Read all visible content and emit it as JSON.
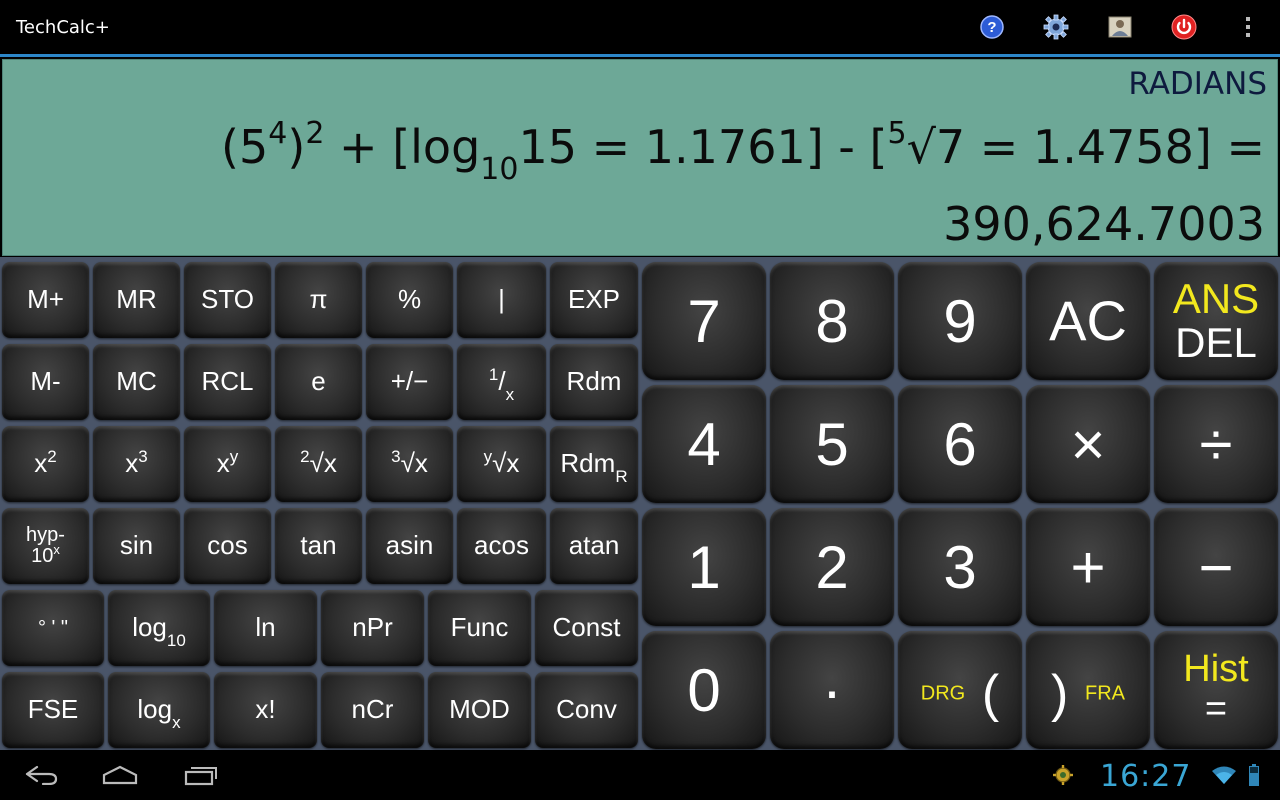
{
  "app": {
    "title": "TechCalc+"
  },
  "actionbar": {
    "icons": [
      "help-icon",
      "settings-icon",
      "contact-icon",
      "power-icon",
      "overflow-menu-icon"
    ]
  },
  "display": {
    "mode": "RADIANS",
    "expr": {
      "p1": "(5",
      "s1": "4",
      "p2": ")",
      "s2": "2",
      "p3": " + [log",
      "sub1": "10",
      "p4": "15 = 1.1761] - [",
      "s3": "5",
      "p5": "√7 = 1.4758] ="
    },
    "result": "390,624.7003"
  },
  "sci_keys": {
    "m_plus": "M+",
    "mr": "MR",
    "sto": "STO",
    "pi": "π",
    "percent": "%",
    "bar": "|",
    "exp": "EXP",
    "m_minus": "M-",
    "mc": "MC",
    "rcl": "RCL",
    "e": "e",
    "plus_minus": "+/−",
    "recip_num": "1",
    "recip_den": "x",
    "rdm": "Rdm",
    "sq_base": "x",
    "sq_exp": "2",
    "cube_base": "x",
    "cube_exp": "3",
    "pow_base": "x",
    "pow_exp": "y",
    "sqrt_idx": "2",
    "sqrt_body": "√x",
    "cbrt_idx": "3",
    "cbrt_body": "√x",
    "yroot_idx": "y",
    "yroot_body": "√x",
    "rdmr_base": "Rdm",
    "rdmr_sub": "R",
    "hyp": "hyp-",
    "ten_base": "10",
    "ten_exp": "x",
    "sin": "sin",
    "cos": "cos",
    "tan": "tan",
    "asin": "asin",
    "acos": "acos",
    "atan": "atan",
    "dms": "° ' \"",
    "log10_base": "log",
    "log10_sub": "10",
    "ln": "ln",
    "npr": "nPr",
    "func": "Func",
    "const": "Const",
    "fse": "FSE",
    "logx_base": "log",
    "logx_sub": "x",
    "fact": "x!",
    "ncr": "nCr",
    "mod": "MOD",
    "conv": "Conv"
  },
  "num_keys": {
    "seven": "7",
    "eight": "8",
    "nine": "9",
    "ac": "AC",
    "ans": "ANS",
    "del": "DEL",
    "four": "4",
    "five": "5",
    "six": "6",
    "multiply": "×",
    "divide": "÷",
    "one": "1",
    "two": "2",
    "three": "3",
    "plus": "+",
    "minus": "−",
    "zero": "0",
    "point": "·",
    "drg": "DRG",
    "lparen": "(",
    "rparen": ")",
    "fra": "FRA",
    "hist": "Hist",
    "equals": "="
  },
  "statusbar": {
    "clock": "16:27"
  },
  "colors": {
    "display_bg": "#6da897",
    "keypad_bg": "#4a5569",
    "accent_yellow": "#f2e81e",
    "clock_blue": "#3aa6d4",
    "actionbar_divider": "#2c86c8"
  }
}
